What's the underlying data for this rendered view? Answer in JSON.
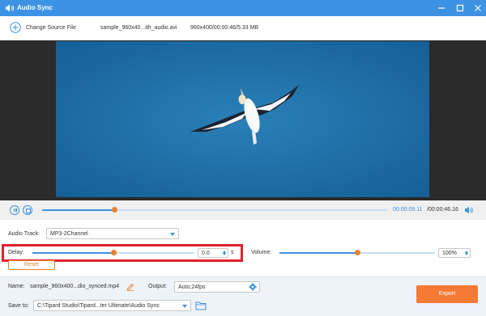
{
  "window": {
    "title": "Audio Sync",
    "minimize_icon": "minimize-icon",
    "maximize_icon": "maximize-icon",
    "close_icon": "close-icon"
  },
  "source": {
    "change_label": "Change Source File",
    "file_name": "sample_960x40...ith_audio.avi",
    "file_info": "960x400/00:00:46/5.33 MB"
  },
  "player": {
    "current_time": "00:00:09.11",
    "total_time": "/00:00:46.16",
    "progress": 0.21
  },
  "settings": {
    "audio_track_label": "Audio Track:",
    "audio_track_value": "MP3-2Channel",
    "delay_label": "Delay:",
    "delay_value": "0.0",
    "delay_unit": "s",
    "delay_slider_level": 0.5,
    "volume_label": "Volume:",
    "volume_value": "100%",
    "volume_slider_level": 0.5,
    "reset_label": "Reset"
  },
  "bottom": {
    "name_label": "Name:",
    "name_value": "sample_960x400...dio_synced.mp4",
    "output_label": "Output:",
    "output_value": "Auto;24fps",
    "save_to_label": "Save to:",
    "save_to_value": "C:\\Tipard Studio\\Tipard...ter Ultimate\\Audio Sync",
    "export_label": "Export"
  },
  "colors": {
    "accent": "#3d93e3",
    "orange": "#f07f2b",
    "highlight_red": "#e0222a"
  }
}
